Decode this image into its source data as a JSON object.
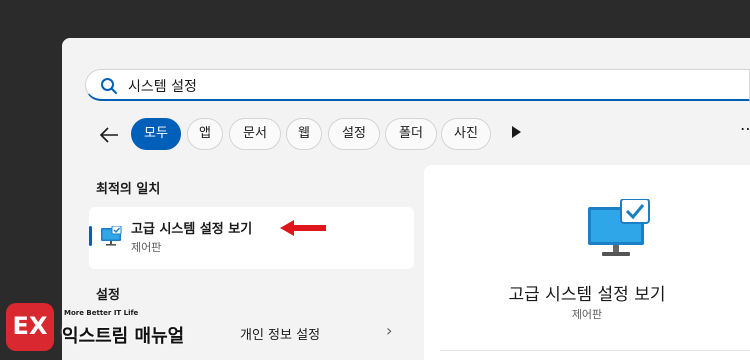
{
  "search": {
    "value": "시스템 설정"
  },
  "filters": [
    "모두",
    "앱",
    "문서",
    "웹",
    "설정",
    "폴더",
    "사진"
  ],
  "best_match": {
    "heading": "최적의 일치",
    "title": "고급 시스템 설정 보기",
    "subtitle": "제어판"
  },
  "settings_section": {
    "heading": "설정",
    "items": [
      {
        "label": "개인 정보 설정"
      }
    ]
  },
  "preview": {
    "title": "고급 시스템 설정 보기",
    "subtitle": "제어판"
  },
  "watermark": {
    "logo_text": "EX",
    "tagline": "More Better IT Life",
    "name": "익스트림 매뉴얼"
  },
  "colors": {
    "accent": "#005fb8",
    "annotation_arrow": "#e0161d",
    "watermark": "#d9282f"
  },
  "icons": {
    "search": "search-icon",
    "back": "arrow-left-icon",
    "more_filters": "play-icon",
    "app": "monitor-check-icon"
  }
}
